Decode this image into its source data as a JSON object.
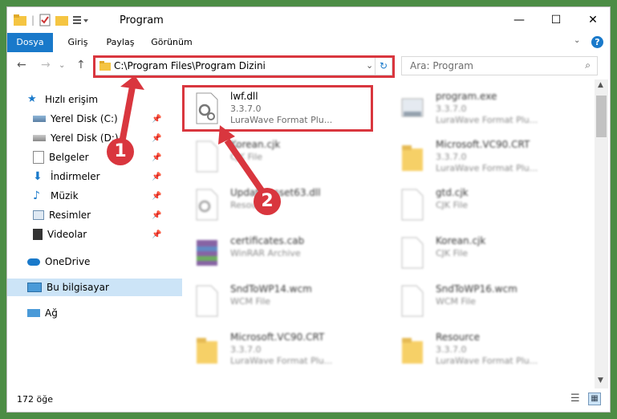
{
  "window": {
    "title": "Program",
    "minimize": "—",
    "maximize": "☐",
    "close": "✕"
  },
  "ribbon": {
    "tabs": [
      "Dosya",
      "Giriş",
      "Paylaş",
      "Görünüm"
    ],
    "help": "?"
  },
  "address": {
    "path": "C:\\Program Files\\Program Dizini",
    "search_placeholder": "Ara: Program"
  },
  "nav": {
    "items": [
      {
        "label": "Hızlı erişim"
      },
      {
        "label": "Yerel Disk (C:)"
      },
      {
        "label": "Yerel Disk (D:)"
      },
      {
        "label": "Belgeler"
      },
      {
        "label": "İndirmeler"
      },
      {
        "label": "Müzik"
      },
      {
        "label": "Resimler"
      },
      {
        "label": "Videolar"
      },
      {
        "label": "OneDrive"
      },
      {
        "label": "Bu bilgisayar"
      },
      {
        "label": "Ağ"
      }
    ]
  },
  "files": [
    {
      "name": "lwf.dll",
      "line1": "3.3.7.0",
      "line2": "LuraWave Format Plu...",
      "icon": "dll-gear-icon"
    },
    {
      "name": "program.exe",
      "line1": "3.3.7.0",
      "line2": "LuraWave Format Plu...",
      "icon": "exe-icon"
    },
    {
      "name": "Korean.cjk",
      "line1": "CJK File",
      "line2": "",
      "icon": "blank-file-icon"
    },
    {
      "name": "Microsoft.VC90.CRT",
      "line1": "3.3.7.0",
      "line2": "LuraWave Format Plu...",
      "icon": "folder-icon"
    },
    {
      "name": "Update.asset63.dll",
      "line1": "Resource",
      "line2": "",
      "icon": "dll-gear-icon"
    },
    {
      "name": "gtd.cjk",
      "line1": "CJK File",
      "line2": "",
      "icon": "blank-file-icon"
    },
    {
      "name": "certificates.cab",
      "line1": "WinRAR Archive",
      "line2": "",
      "icon": "archive-icon"
    },
    {
      "name": "Korean.cjk",
      "line1": "CJK File",
      "line2": "",
      "icon": "blank-file-icon"
    },
    {
      "name": "SndToWP14.wcm",
      "line1": "WCM File",
      "line2": "",
      "icon": "blank-file-icon"
    },
    {
      "name": "SndToWP16.wcm",
      "line1": "WCM File",
      "line2": "",
      "icon": "blank-file-icon"
    },
    {
      "name": "Microsoft.VC90.CRT",
      "line1": "3.3.7.0",
      "line2": "LuraWave Format Plu...",
      "icon": "folder-icon"
    },
    {
      "name": "Resource",
      "line1": "3.3.7.0",
      "line2": "LuraWave Format Plu...",
      "icon": "folder-icon"
    }
  ],
  "status": {
    "count": "172 öğe"
  },
  "annotations": {
    "badge1": "1",
    "badge2": "2"
  },
  "colors": {
    "accent": "#1979ca",
    "highlight": "#d9363e",
    "selected_nav": "#cce4f7"
  }
}
